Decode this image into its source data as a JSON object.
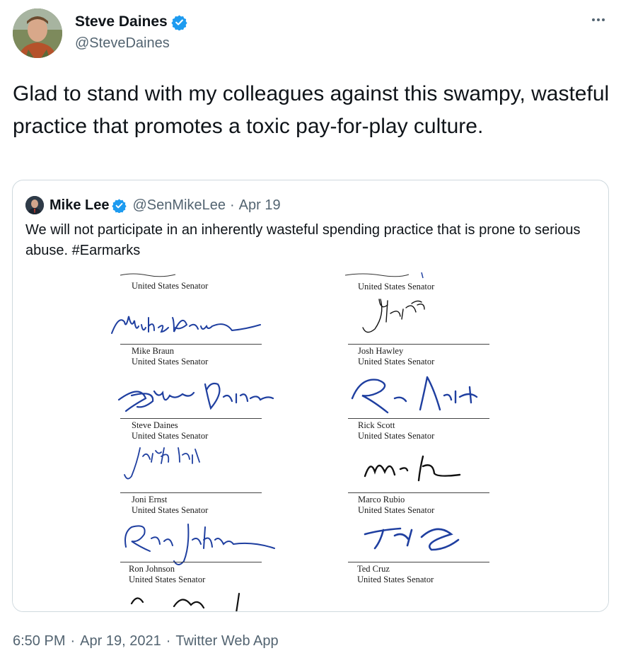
{
  "author": {
    "display_name": "Steve Daines",
    "handle": "@SteveDaines"
  },
  "tweet": {
    "text": "Glad to stand with my colleagues against this swampy, wasteful practice that promotes a toxic pay-for-play culture."
  },
  "quoted": {
    "display_name": "Mike Lee",
    "handle": "@SenMikeLee",
    "separator": "·",
    "date": "Apr 19",
    "text": "We will not participate in an inherently wasteful spending practice that is prone to serious abuse. #Earmarks",
    "signatures": [
      {
        "name": "",
        "title": "United States Senator"
      },
      {
        "name": "",
        "title": "United States Senator"
      },
      {
        "name": "Mike Braun",
        "title": "United States Senator"
      },
      {
        "name": "Josh Hawley",
        "title": "United States Senator"
      },
      {
        "name": "Steve Daines",
        "title": "United States Senator"
      },
      {
        "name": "Rick Scott",
        "title": "United States Senator"
      },
      {
        "name": "Joni Ernst",
        "title": "United States Senator"
      },
      {
        "name": "Marco Rubio",
        "title": "United States Senator"
      },
      {
        "name": "Ron Johnson",
        "title": "United States Senator"
      },
      {
        "name": "Ted Cruz",
        "title": "United States Senator"
      }
    ]
  },
  "footer": {
    "time": "6:50 PM",
    "date": "Apr 19, 2021",
    "source": "Twitter Web App",
    "separator": "·"
  },
  "colors": {
    "verified_badge": "#1d9bf0",
    "secondary_text": "#536471",
    "ink_blue": "#1f3fa0",
    "ink_black": "#111111"
  },
  "icons": {
    "verified": "verified-badge-icon",
    "more": "more-horizontal-icon"
  }
}
